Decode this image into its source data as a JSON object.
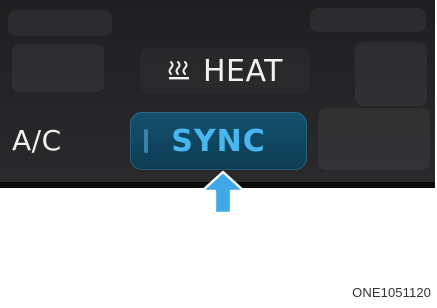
{
  "controls": {
    "heat": {
      "label": "HEAT",
      "icon": "heat-icon"
    },
    "ac": {
      "label": "A/C"
    },
    "sync": {
      "label": "SYNC",
      "state": "highlighted"
    }
  },
  "pointer": {
    "icon": "up-arrow-icon",
    "color": "#3ea9e6"
  },
  "caption": {
    "code": "ONE1051120"
  },
  "colors": {
    "panel_background": "#222225",
    "sync_background": "#0d3d54",
    "sync_text": "#48b7ef",
    "panel_text": "#f2f2f2",
    "page_background": "#ffffff"
  }
}
